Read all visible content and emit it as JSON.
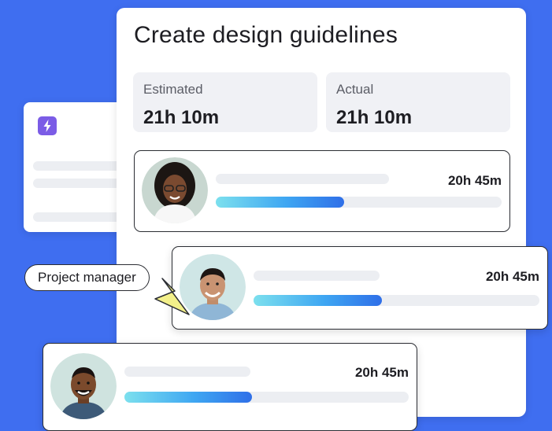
{
  "task": {
    "title": "Create design guidelines",
    "estimated_label": "Estimated",
    "estimated_value": "21h 10m",
    "actual_label": "Actual",
    "actual_value": "21h 10m"
  },
  "tag": {
    "label": "Project manager"
  },
  "assignees": [
    {
      "duration": "20h 45m",
      "progress": 0.45
    },
    {
      "duration": "20h 45m",
      "progress": 0.45
    },
    {
      "duration": "20h 45m",
      "progress": 0.45
    }
  ],
  "colors": {
    "background": "#3f6ef0",
    "bolt_badge": "#7b5ce6",
    "tag_pointer": "#f3f08a",
    "progress_gradient": [
      "#7ce0ee",
      "#3ea6f2",
      "#2f6fe8"
    ]
  },
  "icons": {
    "background_card_badge": "bolt-icon"
  }
}
